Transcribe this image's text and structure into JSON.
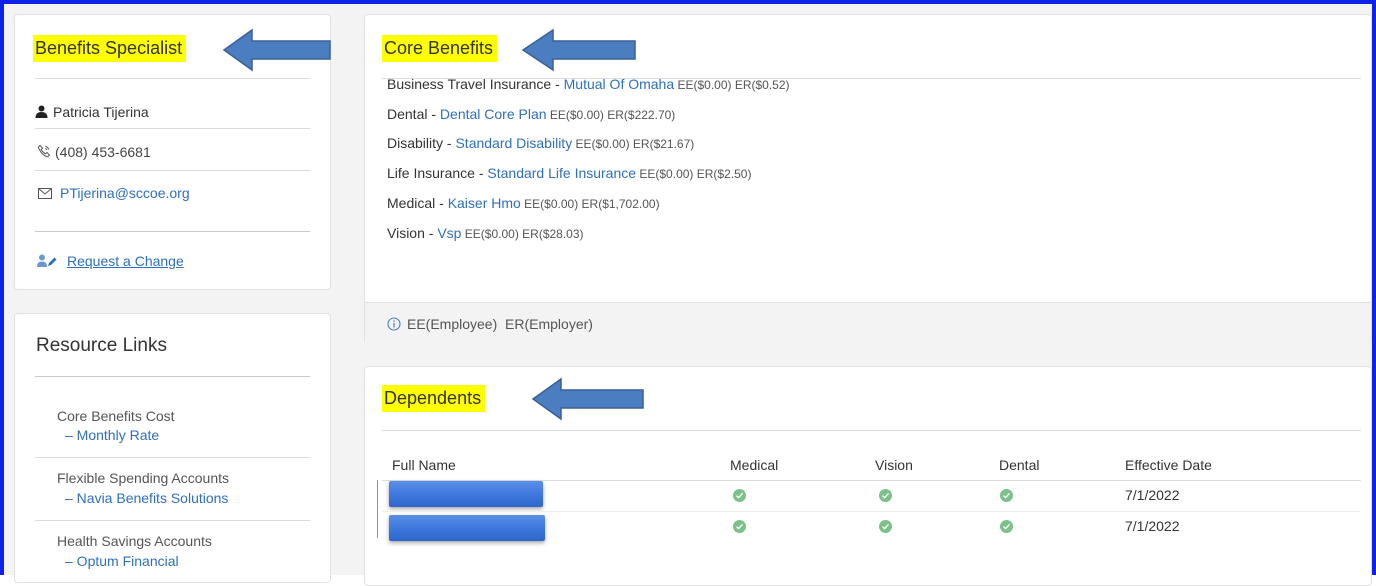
{
  "specialist": {
    "title": "Benefits Specialist",
    "name": "Patricia Tijerina",
    "phone": "(408) 453-6681",
    "email": "PTijerina@sccoe.org",
    "request_change": "Request a Change"
  },
  "resources": {
    "title": "Resource Links",
    "items": [
      {
        "label": "Core Benefits Cost",
        "link": "– Monthly Rate"
      },
      {
        "label": "Flexible Spending Accounts",
        "link": "– Navia Benefits Solutions"
      },
      {
        "label": "Health Savings Accounts",
        "link": "– Optum Financial"
      }
    ]
  },
  "core": {
    "title": "Core Benefits",
    "rows": [
      {
        "category": "Business Travel Insurance - ",
        "plan": "Mutual Of Omaha",
        "amounts": " EE($0.00) ER($0.52)"
      },
      {
        "category": "Dental - ",
        "plan": "Dental Core Plan",
        "amounts": " EE($0.00) ER($222.70)"
      },
      {
        "category": "Disability - ",
        "plan": "Standard Disability",
        "amounts": " EE($0.00) ER($21.67)"
      },
      {
        "category": "Life Insurance - ",
        "plan": "Standard Life Insurance",
        "amounts": " EE($0.00) ER($2.50)"
      },
      {
        "category": "Medical - ",
        "plan": "Kaiser Hmo",
        "amounts": " EE($0.00) ER($1,702.00)"
      },
      {
        "category": "Vision - ",
        "plan": "Vsp",
        "amounts": " EE($0.00) ER($28.03)"
      }
    ],
    "footnote": "EE(Employee)  ER(Employer)"
  },
  "dependents": {
    "title": "Dependents",
    "headers": [
      "Full Name",
      "Medical",
      "Vision",
      "Dental",
      "Effective Date"
    ],
    "rows": [
      {
        "medical": true,
        "vision": true,
        "dental": true,
        "effective_date": "7/1/2022"
      },
      {
        "medical": true,
        "vision": true,
        "dental": true,
        "effective_date": "7/1/2022"
      }
    ]
  },
  "colors": {
    "highlight": "#ffff00",
    "arrow": "#4a7ec0",
    "frame": "#0d23e8",
    "link": "#2f6fbf",
    "check": "#7cc08a"
  },
  "icons": [
    "person-icon",
    "phone-icon",
    "mail-icon",
    "user-edit-icon",
    "info-icon",
    "check-circle-icon",
    "left-arrow-annotation"
  ]
}
